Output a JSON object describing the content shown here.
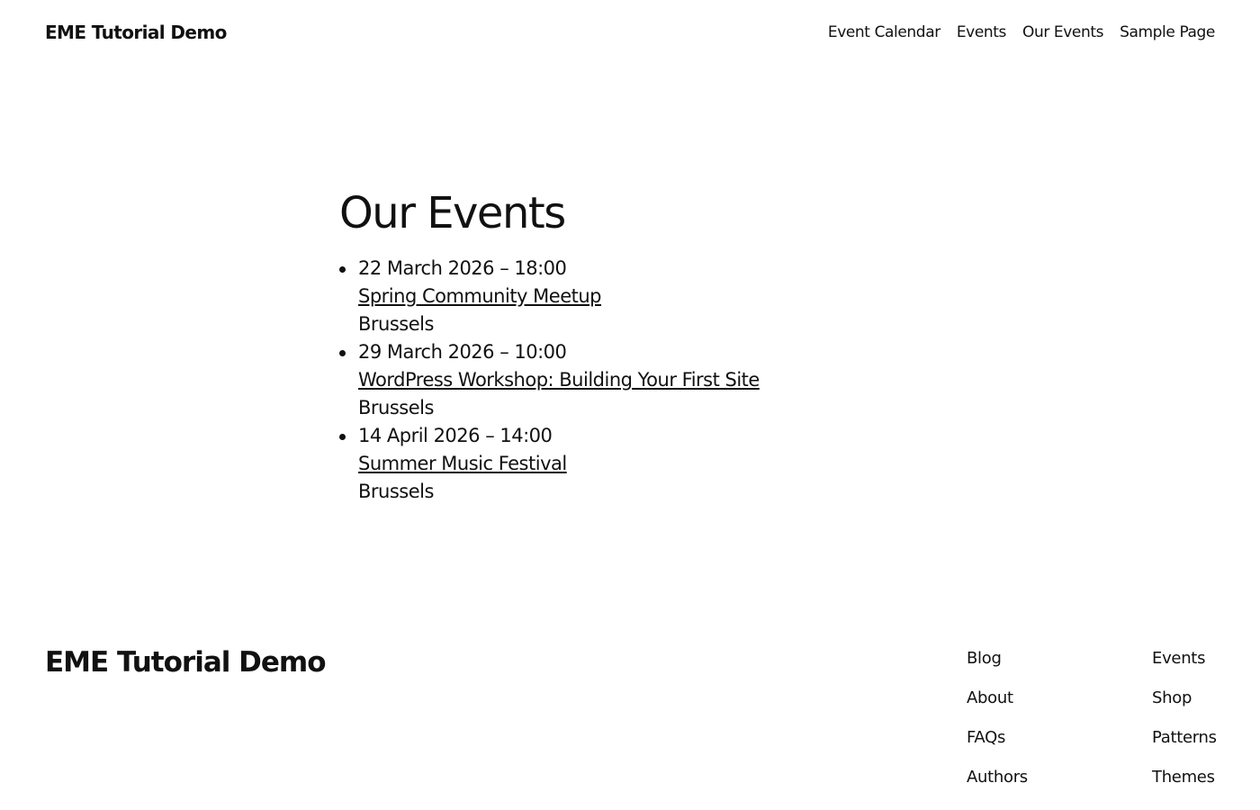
{
  "header": {
    "site_title": "EME Tutorial Demo",
    "nav": [
      {
        "label": "Event Calendar"
      },
      {
        "label": "Events"
      },
      {
        "label": "Our Events"
      },
      {
        "label": "Sample Page"
      }
    ]
  },
  "main": {
    "title": "Our Events",
    "events": [
      {
        "datetime": "22 March 2026 – 18:00",
        "name": "Spring Community Meetup",
        "location": "Brussels"
      },
      {
        "datetime": "29 March 2026 – 10:00",
        "name": "WordPress Workshop: Building Your First Site",
        "location": "Brussels"
      },
      {
        "datetime": "14 April 2026 – 14:00",
        "name": "Summer Music Festival",
        "location": "Brussels"
      }
    ]
  },
  "footer": {
    "site_title": "EME Tutorial Demo",
    "links_col1": [
      {
        "label": "Blog"
      },
      {
        "label": "About"
      },
      {
        "label": "FAQs"
      },
      {
        "label": "Authors"
      }
    ],
    "links_col2": [
      {
        "label": "Events"
      },
      {
        "label": "Shop"
      },
      {
        "label": "Patterns"
      },
      {
        "label": "Themes"
      }
    ]
  },
  "colors": {
    "text": "#111111",
    "background": "#ffffff"
  }
}
